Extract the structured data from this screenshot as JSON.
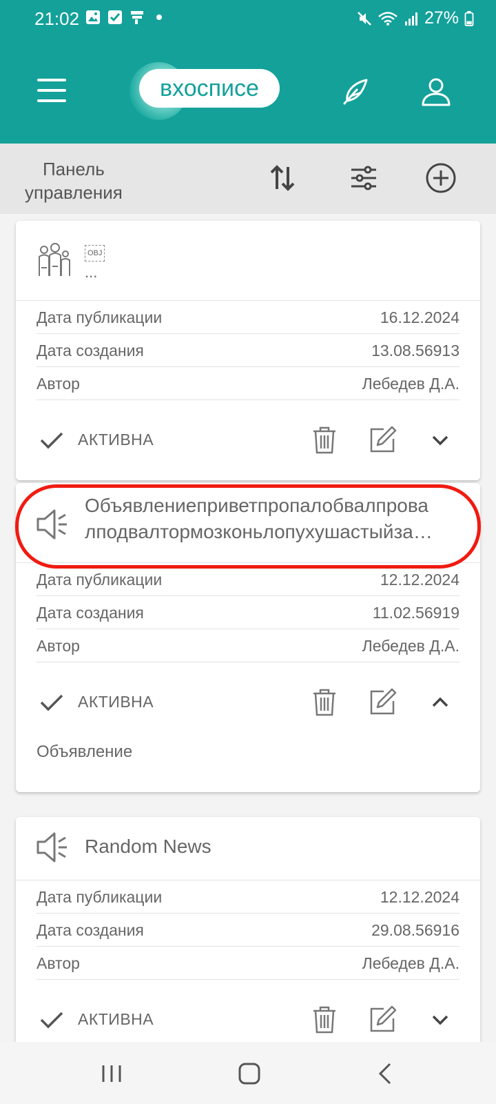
{
  "status_bar": {
    "time": "21:02",
    "battery": "27%",
    "left_icons": [
      "image-icon",
      "checkbox-icon",
      "flag-icon",
      "dot-icon"
    ],
    "right_icons": [
      "mute-icon",
      "wifi-icon",
      "signal-icon",
      "battery-icon"
    ]
  },
  "header": {
    "logo_text": "вхосписе",
    "accent_color": "#13a19a"
  },
  "toolbar": {
    "title_line1": "Панель",
    "title_line2": "управления"
  },
  "cards": [
    {
      "icon": "family-icon",
      "title_badge": "OBJ",
      "title": "...",
      "rows": [
        {
          "label": "Дата публикации",
          "value": "16.12.2024"
        },
        {
          "label": "Дата создания",
          "value": "13.08.56913"
        },
        {
          "label": "Автор",
          "value": "Лебедев Д.А."
        }
      ],
      "status": "АКТИВНА",
      "expand": "chevron-down-icon"
    },
    {
      "icon": "megaphone-icon",
      "title_line1": "Объявлениеприветпропалобвалпрова",
      "title_line2": "лподвалтормозконьлопухушастыйза…",
      "rows": [
        {
          "label": "Дата публикации",
          "value": "12.12.2024"
        },
        {
          "label": "Дата создания",
          "value": "11.02.56919"
        },
        {
          "label": "Автор",
          "value": "Лебедев Д.А."
        }
      ],
      "status": "АКТИВНА",
      "expand": "chevron-up-icon",
      "extra": "Объявление"
    },
    {
      "icon": "megaphone-icon",
      "title": "Random News",
      "rows": [
        {
          "label": "Дата публикации",
          "value": "12.12.2024"
        },
        {
          "label": "Дата создания",
          "value": "29.08.56916"
        },
        {
          "label": "Автор",
          "value": "Лебедев Д.А."
        }
      ],
      "status": "АКТИВНА",
      "expand": "chevron-down-icon"
    }
  ],
  "highlight_color": "#f01b10",
  "nav_bar": [
    "recent-apps-icon",
    "home-icon",
    "back-icon"
  ]
}
